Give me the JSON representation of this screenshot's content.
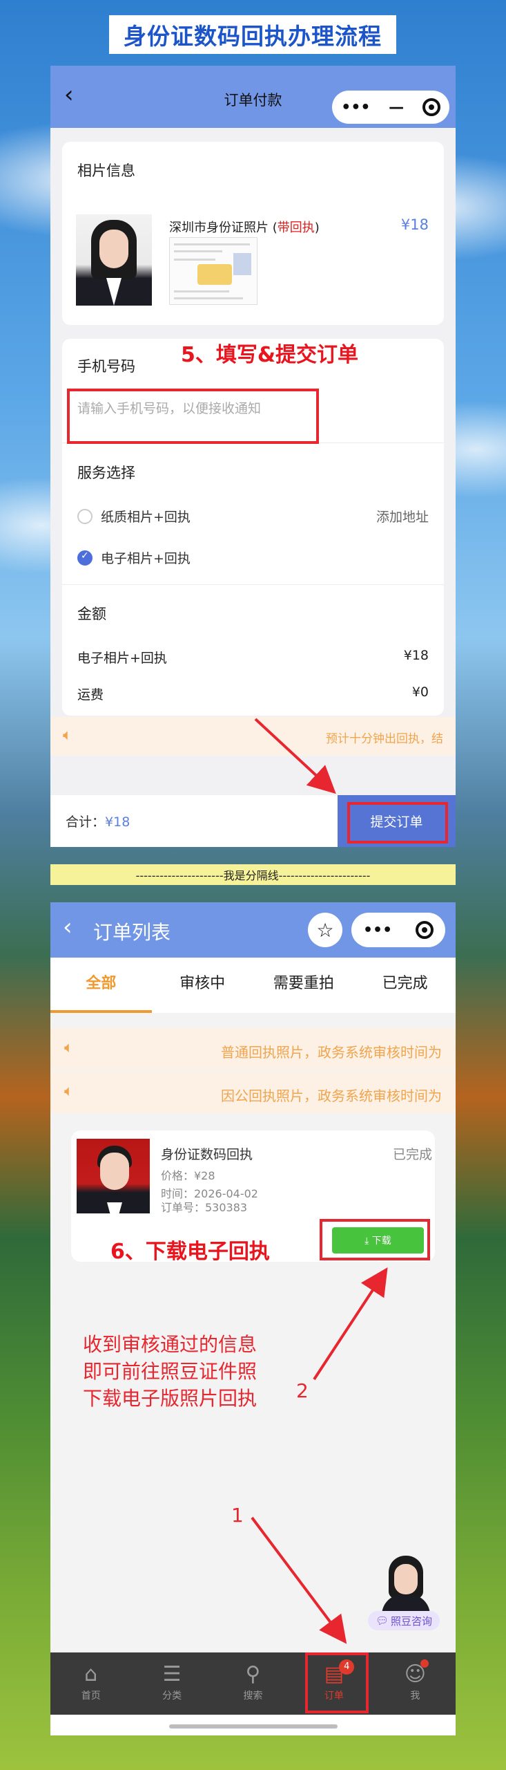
{
  "banner": {
    "title": "身份证数码回执办理流程"
  },
  "checkout": {
    "back_icon": "‹",
    "nav_title": "订单付款",
    "capsule": {
      "more": "•••",
      "minimize": "—"
    },
    "photo_section": {
      "title": "相片信息",
      "product_name": "深圳市身份证照片",
      "product_tag": "带回执",
      "price": "¥18"
    },
    "phone_section": {
      "title": "手机号码",
      "placeholder": "请输入手机号码，以便接收通知",
      "value": ""
    },
    "service_section": {
      "title": "服务选择",
      "options": [
        {
          "label": "纸质相片+回执",
          "selected": false,
          "action": "添加地址"
        },
        {
          "label": "电子相片+回执",
          "selected": true,
          "action": ""
        }
      ]
    },
    "amount_section": {
      "title": "金额",
      "rows": [
        {
          "label": "电子相片+回执",
          "value": "¥18"
        },
        {
          "label": "运费",
          "value": "¥0"
        }
      ]
    },
    "notice": "预计十分钟出回执，结",
    "total_label": "合计：",
    "total_value": "¥18",
    "submit_label": "提交订单",
    "annotation": "5、填写&提交订单"
  },
  "separator": "----------------------我是分隔线-----------------------",
  "orders": {
    "back_icon": "‹",
    "nav_title": "订单列表",
    "star_icon": "☆",
    "capsule": {
      "more": "•••"
    },
    "tabs": [
      {
        "label": "全部",
        "active": true
      },
      {
        "label": "审核中",
        "active": false
      },
      {
        "label": "需要重拍",
        "active": false
      },
      {
        "label": "已完成",
        "active": false
      }
    ],
    "notices": [
      "普通回执照片，政务系统审核时间为",
      "因公回执照片，政务系统审核时间为"
    ],
    "order": {
      "name": "身份证数码回执",
      "status": "已完成",
      "price": "价格：¥28",
      "time": "时间：2026-04-02",
      "order_no": "订单号：530383",
      "download_label": "⤓ 下载"
    },
    "annotation": "6、下载电子回执",
    "note_lines": [
      "收到审核通过的信息",
      "即可前往照豆证件照",
      "下载电子版照片回执"
    ],
    "marker_1": "1",
    "marker_2": "2",
    "advisor_label": "照豆咨询",
    "tabbar": [
      {
        "label": "首页",
        "icon": "⌂",
        "icon_name": "home-icon",
        "active": false
      },
      {
        "label": "分类",
        "icon": "☰",
        "icon_name": "category-icon",
        "active": false
      },
      {
        "label": "搜索",
        "icon": "⚲",
        "icon_name": "search-icon",
        "active": false
      },
      {
        "label": "订单",
        "icon": "▤",
        "icon_name": "order-icon",
        "active": true,
        "badge": "4"
      },
      {
        "label": "我",
        "icon": "☺",
        "icon_name": "profile-icon",
        "active": false
      }
    ]
  },
  "colors": {
    "accent": "#7196e6",
    "annotation": "#e8262f",
    "highlight": "#f0992e",
    "download": "#48c33e"
  }
}
